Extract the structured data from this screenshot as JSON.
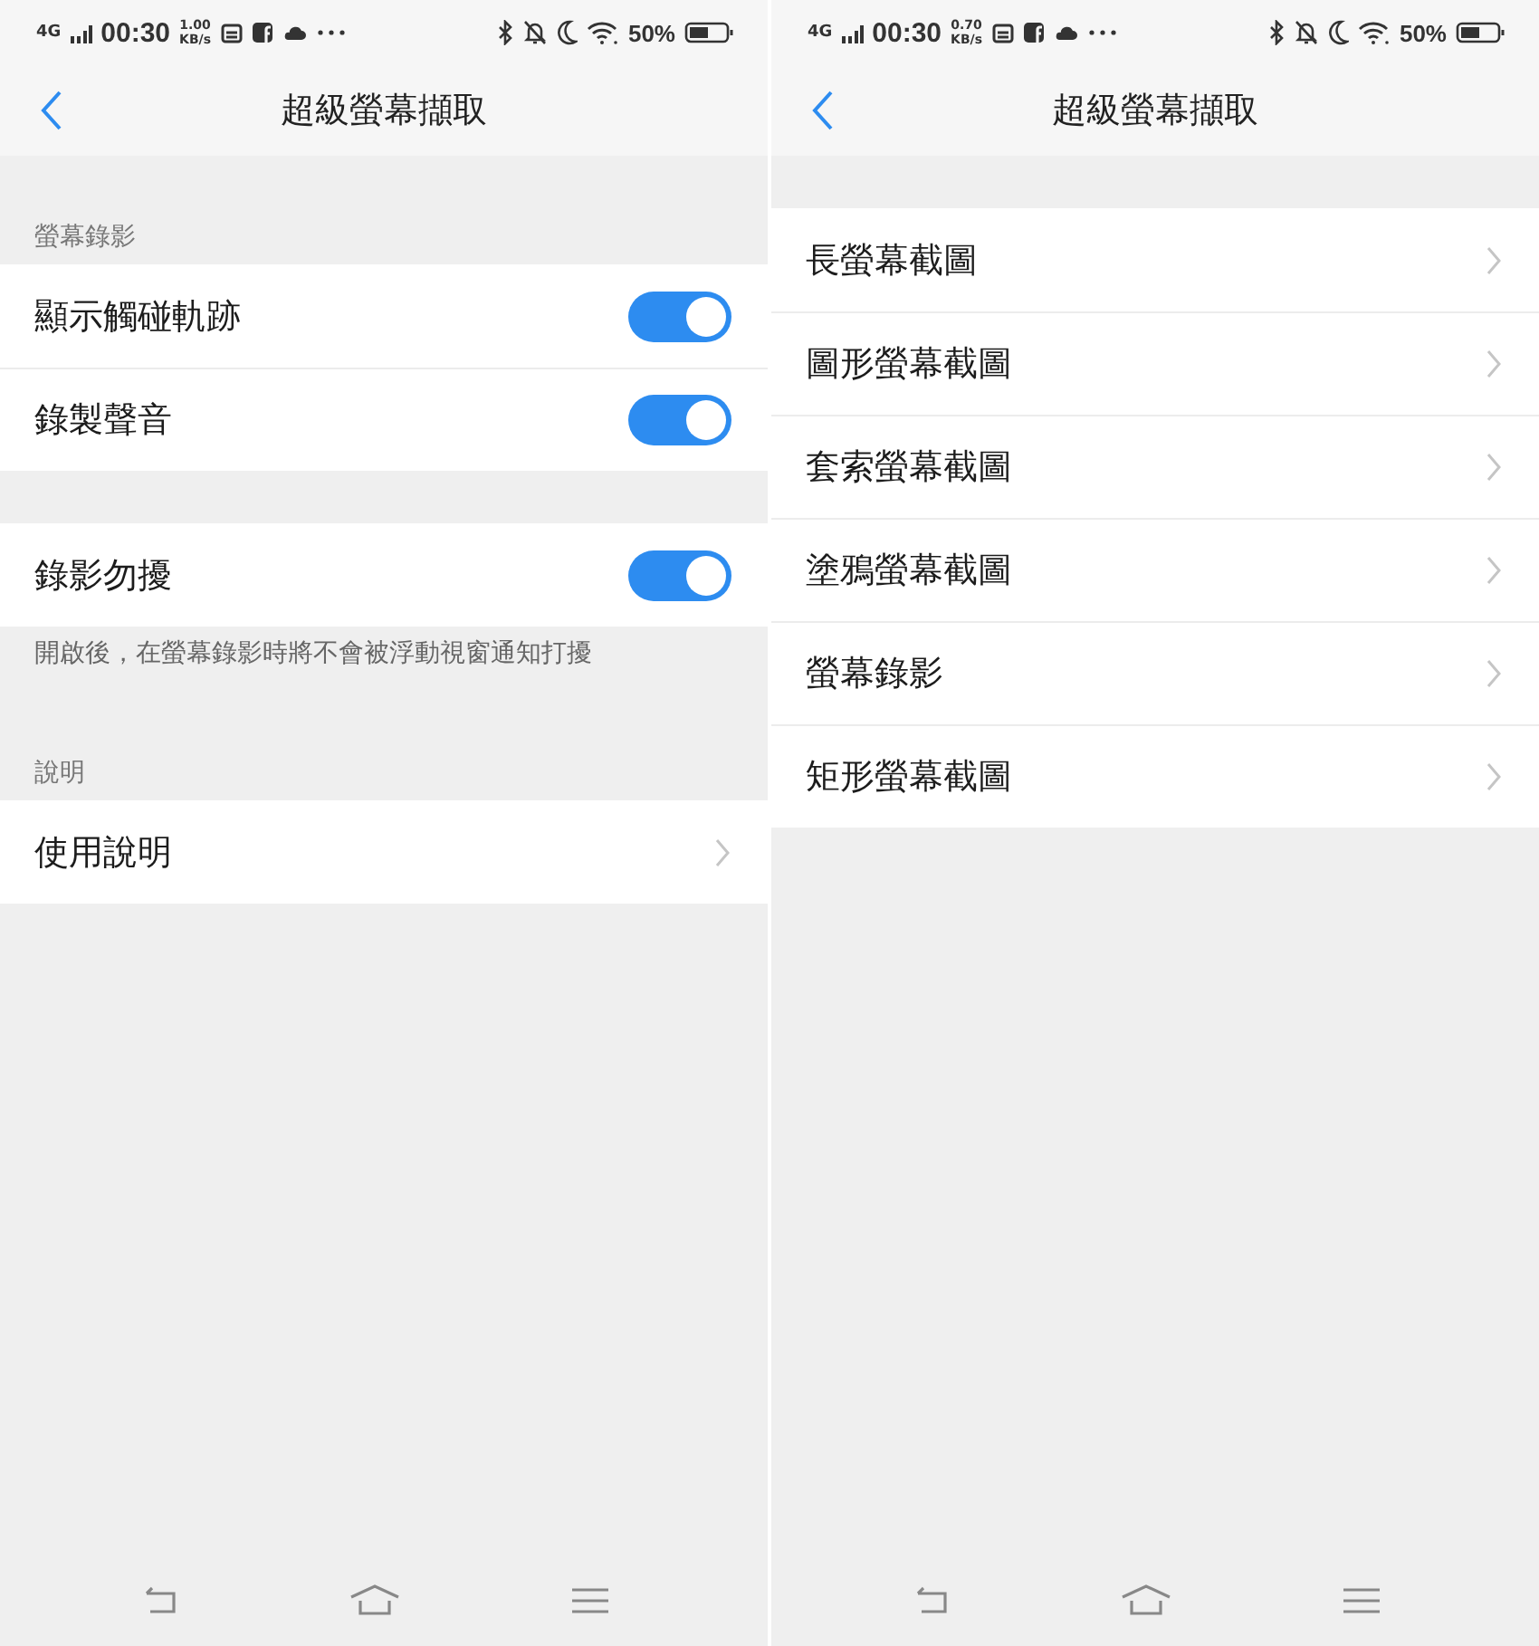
{
  "screens": [
    {
      "status_bar": {
        "network": "4G",
        "time": "00:30",
        "speed": "1.00",
        "speed_unit": "KB/s",
        "battery": "50%"
      },
      "header": {
        "title": "超級螢幕擷取"
      },
      "sections": [
        {
          "label": "螢幕錄影",
          "rows": [
            {
              "kind": "toggle",
              "label": "顯示觸碰軌跡",
              "on": true
            },
            {
              "kind": "toggle",
              "label": "錄製聲音",
              "on": true
            }
          ]
        },
        {
          "rows": [
            {
              "kind": "toggle",
              "label": "錄影勿擾",
              "on": true
            }
          ],
          "note": "開啟後，在螢幕錄影時將不會被浮動視窗通知打擾"
        },
        {
          "label": "說明",
          "rows": [
            {
              "kind": "link",
              "label": "使用說明"
            }
          ]
        }
      ]
    },
    {
      "status_bar": {
        "network": "4G",
        "time": "00:30",
        "speed": "0.70",
        "speed_unit": "KB/s",
        "battery": "50%"
      },
      "header": {
        "title": "超級螢幕擷取"
      },
      "sections": [
        {
          "rows": [
            {
              "kind": "link",
              "label": "長螢幕截圖"
            },
            {
              "kind": "link",
              "label": "圖形螢幕截圖"
            },
            {
              "kind": "link",
              "label": "套索螢幕截圖"
            },
            {
              "kind": "link",
              "label": "塗鴉螢幕截圖"
            },
            {
              "kind": "link",
              "label": "螢幕錄影"
            },
            {
              "kind": "link",
              "label": "矩形螢幕截圖"
            }
          ]
        }
      ]
    }
  ]
}
